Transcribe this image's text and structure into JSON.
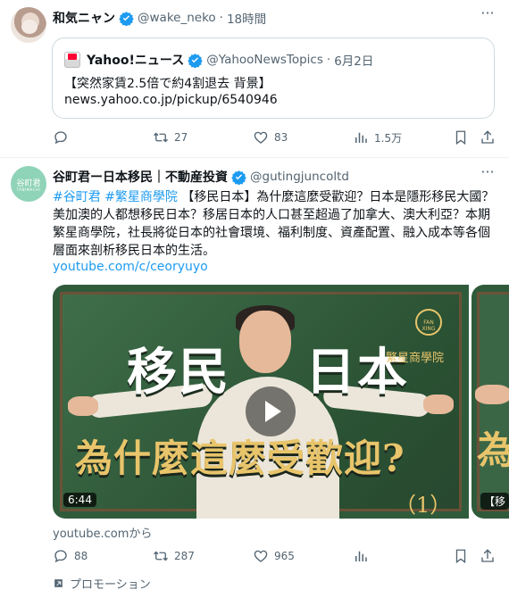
{
  "tweet1": {
    "author_name": "和気ニャン",
    "handle": "@wake_neko",
    "separator": "·",
    "time": "18時間",
    "quote": {
      "author_name": "Yahoo!ニュース",
      "handle": "@YahooNewsTopics",
      "separator": "·",
      "date": "6月2日",
      "text": "【突然家賃2.5倍で約4割退去 背景】",
      "url": "news.yahoo.co.jp/pickup/6540946"
    },
    "actions": {
      "reply_count": "",
      "retweet_count": "27",
      "like_count": "83",
      "view_count": "1.5万"
    }
  },
  "tweet2": {
    "author_name": "谷町君ー日本移民｜不動産投資",
    "handle": "@gutingjuncoltd",
    "avatar_text": "谷町君",
    "avatar_subtext": "TANIMACHI",
    "text": {
      "hashtag1": "#谷町君",
      "hashtag2": "#繁星商學院",
      "body": "【移民日本】為什麼這麼受歡迎？日本是隱形移民大國？美加澳的人都想移民日本？移居日本的人口甚至超過了加拿大、澳大利亞？本期繁星商學院，社長將從日本的社會環境、福利制度、資產配置、融入成本等各個層面來剖析移民日本的生活。"
    },
    "link": "youtube.com/c/ceoryuyo",
    "video": {
      "title_left": "移民",
      "title_right": "日本",
      "subtitle": "為什麼這麼受歡迎?",
      "episode": "（1）",
      "school": "繁星商學院",
      "badge": "FAN XING",
      "duration": "6:44"
    },
    "video2": {
      "tag": "【移",
      "subtitle": "為"
    },
    "source": "youtube.comから",
    "actions": {
      "reply_count": "88",
      "retweet_count": "287",
      "like_count": "965"
    },
    "promo_label": "プロモーション"
  },
  "colors": {
    "accent": "#1d9bf0",
    "text_primary": "#0f1419",
    "text_secondary": "#536471",
    "border": "#cfd9de"
  }
}
